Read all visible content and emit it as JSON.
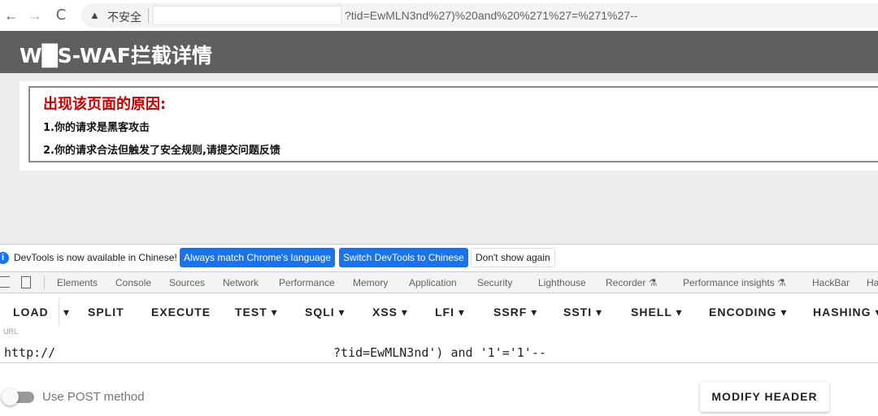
{
  "browser": {
    "back_glyph": "←",
    "forward_glyph": "→",
    "reload_glyph": "C",
    "warning_glyph": "▲",
    "insecure_label": "不安全",
    "url_visible": "?tid=EwMLN3nd%27)%20and%20%271%27=%271%27--"
  },
  "page": {
    "title": "W█S-WAF拦截详情",
    "reason_title": "出现该页面的原因:",
    "reasons": [
      "1.你的请求是黑客攻击",
      "2.你的请求合法但触发了安全规则,请提交问题反馈"
    ]
  },
  "devtools": {
    "notice": {
      "text": "DevTools is now available in Chinese!",
      "match_button": "Always match Chrome's language",
      "switch_button": "Switch DevTools to Chinese",
      "dismiss_button": "Don't show again"
    },
    "tabs": [
      "Elements",
      "Console",
      "Sources",
      "Network",
      "Performance",
      "Memory",
      "Application",
      "Security",
      "Lighthouse",
      "Recorder ⚗",
      "Performance insights ⚗",
      "HackBar",
      "Ha"
    ]
  },
  "hackbar": {
    "toolbar": [
      "LOAD",
      "▾",
      "SPLIT",
      "EXECUTE",
      "TEST ▾",
      "SQLI ▾",
      "XSS ▾",
      "LFI ▾",
      "SSRF ▾",
      "SSTI ▾",
      "SHELL ▾",
      "ENCODING ▾",
      "HASHING ▾"
    ],
    "url_label": "URL",
    "url_prefix": "http://",
    "url_suffix": "?tid=EwMLN3nd') and '1'='1'--",
    "post_label": "Use POST method",
    "post_enabled": false,
    "modify_header": "MODIFY HEADER"
  },
  "colors": {
    "header_bg": "#5f5f5f",
    "reason_title": "#cc0000",
    "devtools_blue": "#1a73e8"
  }
}
